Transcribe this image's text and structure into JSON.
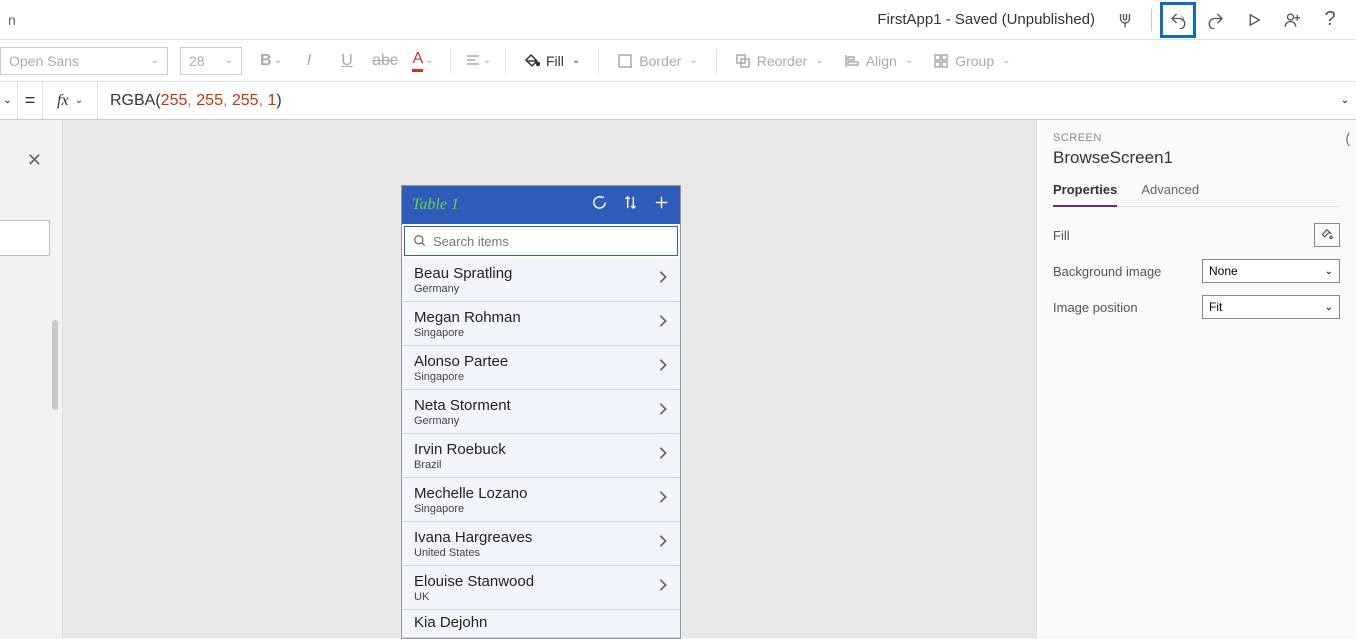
{
  "titlebar": {
    "left_text": "n",
    "app_title": "FirstApp1 - Saved (Unpublished)"
  },
  "toolbar": {
    "font_name": "Open Sans",
    "font_size": "28",
    "fill_label": "Fill",
    "border_label": "Border",
    "reorder_label": "Reorder",
    "align_label": "Align",
    "group_label": "Group"
  },
  "formula": {
    "fn": "RGBA",
    "args": [
      "255",
      "255",
      "255",
      "1"
    ]
  },
  "app": {
    "title": "Table 1",
    "search_placeholder": "Search items",
    "items": [
      {
        "name": "Beau Spratling",
        "sub": "Germany"
      },
      {
        "name": "Megan Rohman",
        "sub": "Singapore"
      },
      {
        "name": "Alonso Partee",
        "sub": "Singapore"
      },
      {
        "name": "Neta Storment",
        "sub": "Germany"
      },
      {
        "name": "Irvin Roebuck",
        "sub": "Brazil"
      },
      {
        "name": "Mechelle Lozano",
        "sub": "Singapore"
      },
      {
        "name": "Ivana Hargreaves",
        "sub": "United States"
      },
      {
        "name": "Elouise Stanwood",
        "sub": "UK"
      },
      {
        "name": "Kia Dejohn",
        "sub": ""
      }
    ]
  },
  "panel": {
    "kind": "SCREEN",
    "name": "BrowseScreen1",
    "tabs": {
      "properties": "Properties",
      "advanced": "Advanced"
    },
    "fill_label": "Fill",
    "bgimg_label": "Background image",
    "bgimg_value": "None",
    "imgpos_label": "Image position",
    "imgpos_value": "Fit"
  }
}
